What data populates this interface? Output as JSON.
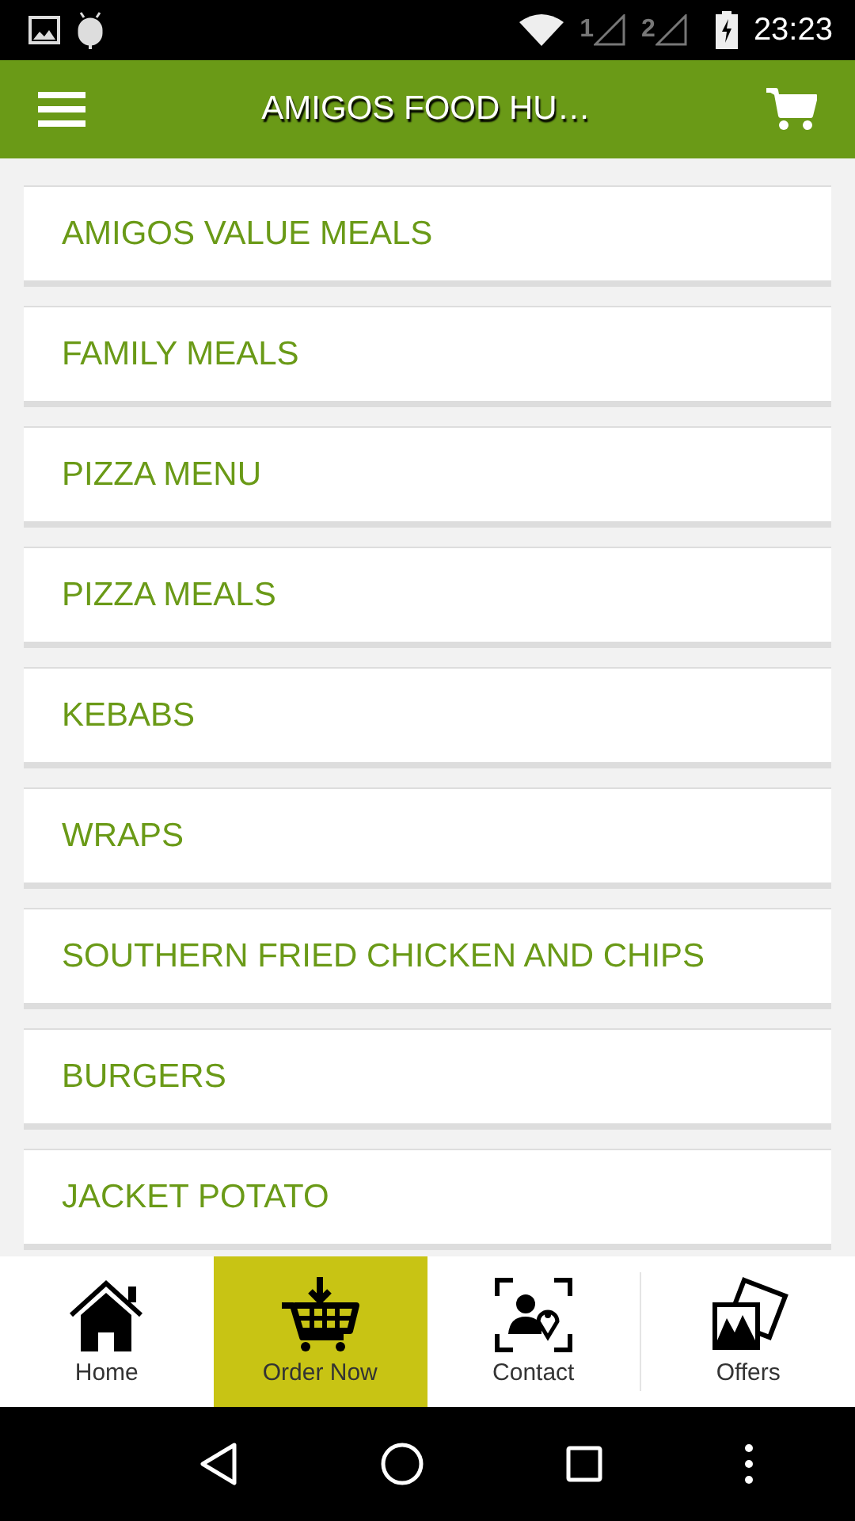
{
  "status_bar": {
    "sim_1": "1",
    "sim_2": "2",
    "time": "23:23"
  },
  "app_bar": {
    "title": "AMIGOS FOOD HU…"
  },
  "categories": [
    {
      "label": "AMIGOS VALUE MEALS"
    },
    {
      "label": "FAMILY MEALS"
    },
    {
      "label": "PIZZA MENU"
    },
    {
      "label": "PIZZA MEALS"
    },
    {
      "label": "KEBABS"
    },
    {
      "label": "WRAPS"
    },
    {
      "label": "SOUTHERN FRIED CHICKEN AND CHIPS"
    },
    {
      "label": "BURGERS"
    },
    {
      "label": "JACKET POTATO"
    }
  ],
  "bottom_nav": [
    {
      "kind": "home",
      "label": "Home",
      "selected": false
    },
    {
      "kind": "order",
      "label": "Order Now",
      "selected": true
    },
    {
      "kind": "contact",
      "label": "Contact",
      "selected": false
    },
    {
      "kind": "offers",
      "label": "Offers",
      "selected": false
    }
  ]
}
